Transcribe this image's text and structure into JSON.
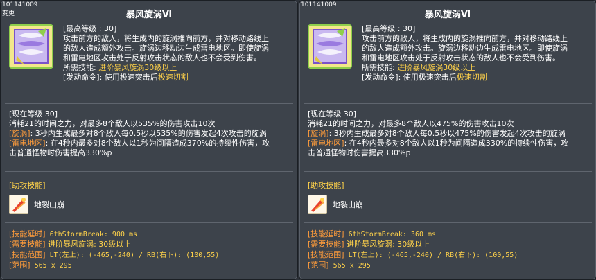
{
  "panels": [
    {
      "skill_id": "101141009",
      "changed_tag": "变更",
      "title": "暴风旋涡Ⅵ",
      "desc": {
        "max_level": "[最高等级 : 30]",
        "line1": "攻击前方的敌人，将生成内的旋涡推向前方，并对移动路线上",
        "line2": "的敌人造成额外攻击。旋涡边移动边生成雷电地区。即使旋涡",
        "line3": "和雷电地区攻击处于反射攻击状态的敌人也不会受到伤害。",
        "req_label": "所需技能: ",
        "req_value": "进阶暴风旋涡30级以上",
        "cmd_label": "[发动命令]: 使用极速突击后",
        "cmd_value": "极速切割"
      },
      "current": {
        "level": "[现在等级 30]",
        "line1": "消耗21的时间之力，对最多8个敌人以535%的伤害攻击10次",
        "vortex_tag": "[旋涡]",
        "vortex_text": ": 3秒内生成最多对8个敌人每0.5秒以535%的伤害发起4次攻击的旋涡",
        "thunder_tag": "[雷电地区]",
        "thunder_text": ": 在4秒内最多对8个敌人以1秒为间隔造成370%的持续性伤害，攻",
        "line4": "击普通怪物时伤害提高330%p"
      },
      "assist_header": "[助攻技能]",
      "assist_skill": "地裂山崩",
      "info": {
        "delay_label": "[技能延时]",
        "delay_value": " 6thStormBreak: 900 ms",
        "need_label": "[需要技能]",
        "need_value": " 进阶暴风旋涡: 30级以上",
        "range_label": "[技能范围]",
        "range_value": " LT(左上): (-465,-240) / RB(右下): (100,55)",
        "area_label": "[范围]",
        "area_value": " 565 x 295"
      }
    },
    {
      "skill_id": "101141009",
      "changed_tag": "",
      "title": "暴风旋涡Ⅵ",
      "desc": {
        "max_level": "[最高等级 : 30]",
        "line1": "攻击前方的敌人，将生成内的旋涡推向前方，并对移动路线上",
        "line2": "的敌人造成额外攻击。旋涡边移动边生成雷电地区。即使旋涡",
        "line3": "和雷电地区攻击处于反射攻击状态的敌人也不会受到伤害。",
        "req_label": "所需技能: ",
        "req_value": "进阶暴风旋涡30级以上",
        "cmd_label": "[发动命令]: 使用极速突击后",
        "cmd_value": "极速切割"
      },
      "current": {
        "level": "[现在等级 30]",
        "line1": "消耗21的时间之力，对最多8个敌人以475%的伤害攻击10次",
        "vortex_tag": "[旋涡]",
        "vortex_text": ": 3秒内生成最多对8个敌人每0.5秒以475%的伤害发起4次攻击的旋涡",
        "thunder_tag": "[雷电地区]",
        "thunder_text": ": 在4秒内最多对8个敌人以1秒为间隔造成330%的持续性伤害，攻",
        "line4": "击普通怪物时伤害提高330%p"
      },
      "assist_header": "[助攻技能]",
      "assist_skill": "地裂山崩",
      "info": {
        "delay_label": "[技能延时]",
        "delay_value": " 6thStormBreak: 360 ms",
        "need_label": "[需要技能]",
        "need_value": " 进阶暴风旋涡: 30级以上",
        "range_label": "[技能范围]",
        "range_value": " LT(左上): (-465,-240) / RB(右下): (100,55)",
        "area_label": "[范围]",
        "area_value": " 565 x 295"
      }
    }
  ],
  "colors": {
    "panel_bg": "#3d434b",
    "highlight_yellow": "#ffd24a",
    "label_orange": "#ff9c3b"
  },
  "icons": {
    "skill_icon": "storm-vortex-icon",
    "assist_icon": "earth-split-icon"
  }
}
